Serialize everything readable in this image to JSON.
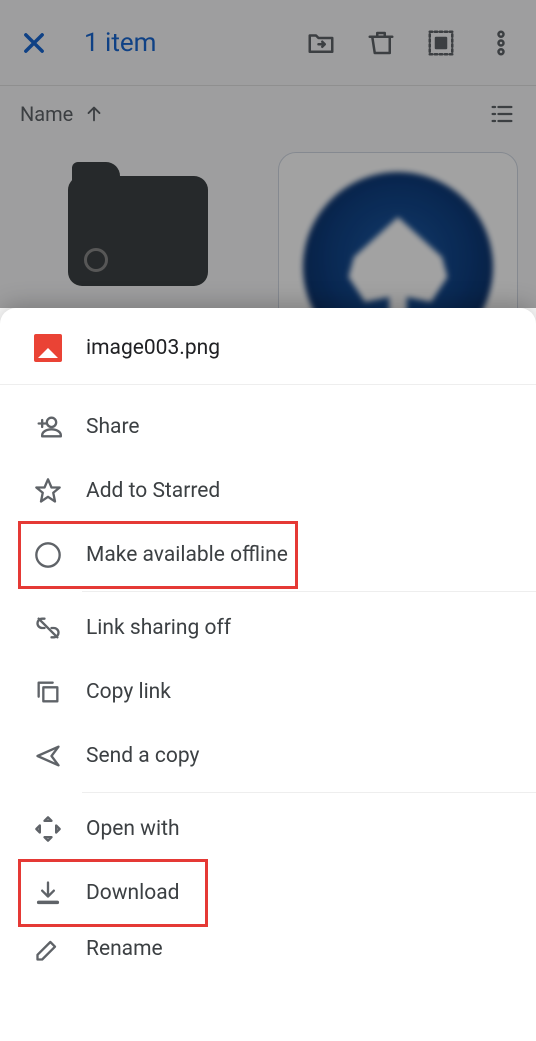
{
  "toolbar": {
    "title": "1 item"
  },
  "sort": {
    "label": "Name"
  },
  "sheet": {
    "filename": "image003.png",
    "share": "Share",
    "star": "Add to Starred",
    "offline": "Make available offline",
    "link_sharing": "Link sharing off",
    "copy_link": "Copy link",
    "send_copy": "Send a copy",
    "open_with": "Open with",
    "download": "Download",
    "rename": "Rename"
  }
}
